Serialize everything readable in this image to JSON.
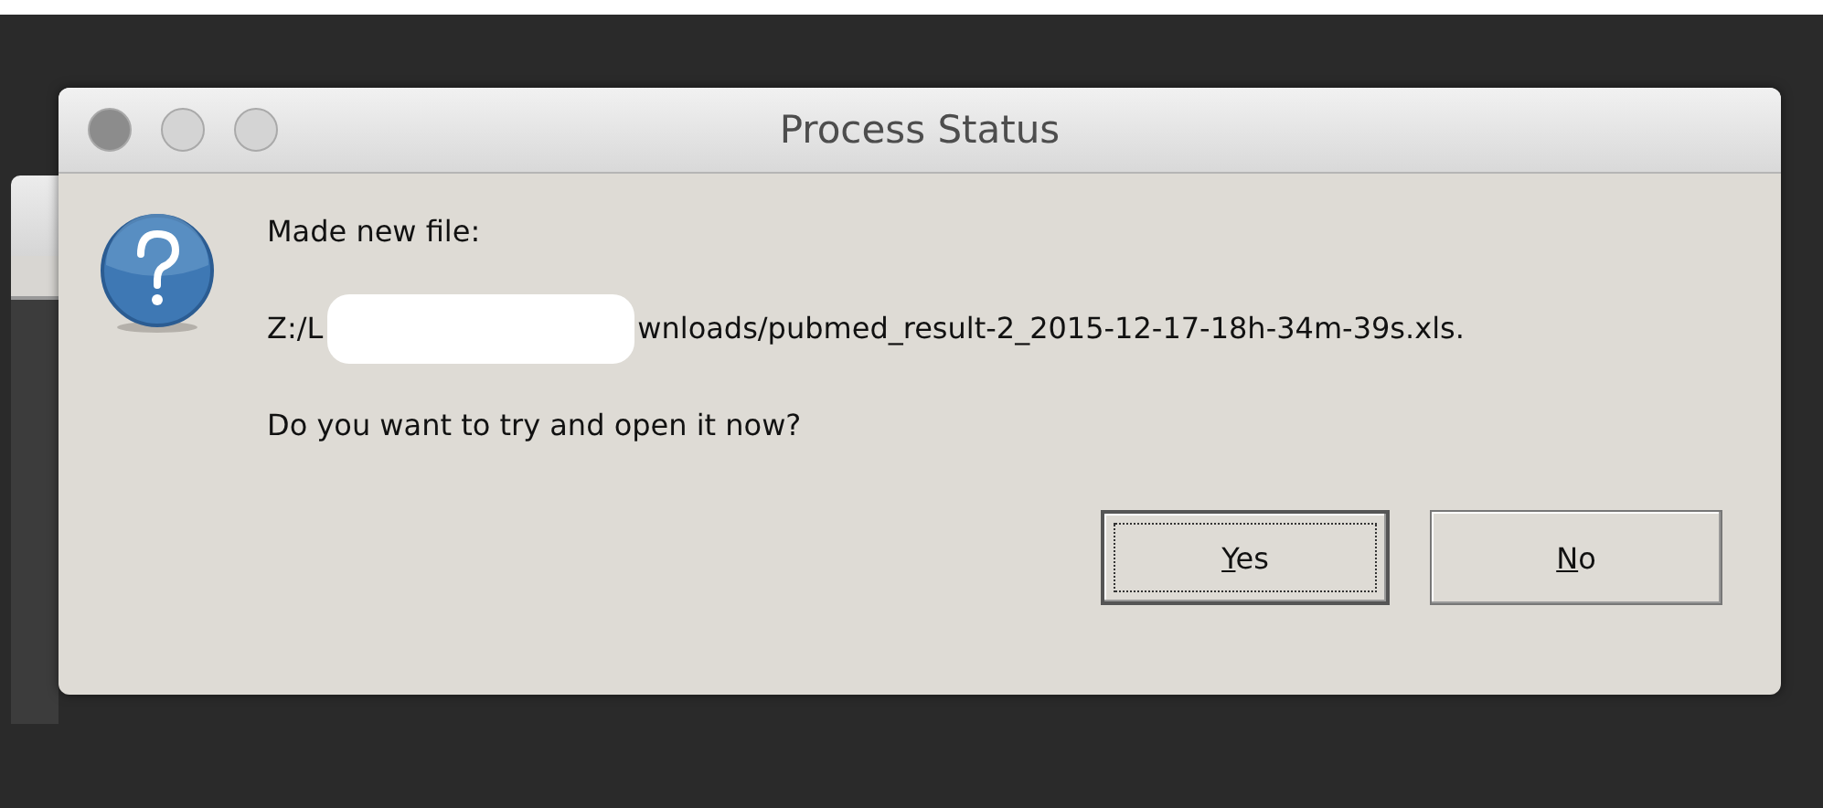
{
  "dialog": {
    "title": "Process Status",
    "kind": "question",
    "message": "Made new file:",
    "path_start": "Z:/L",
    "path_end": "wnloads/pubmed_result-2_2015-12-17-18h-34m-39s.xls.",
    "question": "Do you want to try and open it now?",
    "buttons": [
      {
        "label": "Yes",
        "default": true
      },
      {
        "label": "No",
        "default": false
      }
    ]
  }
}
